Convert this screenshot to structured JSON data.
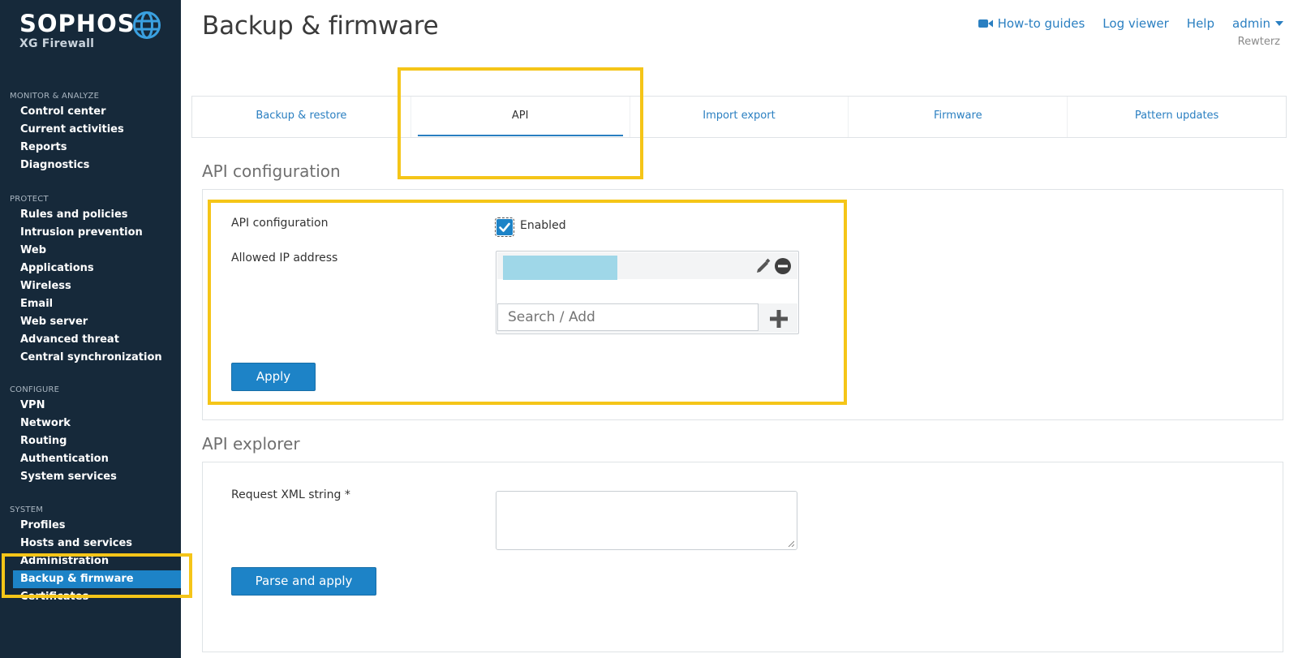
{
  "brand": {
    "name": "SOPHOS",
    "product": "XG Firewall"
  },
  "sidebar": {
    "sections": [
      {
        "heading": "MONITOR & ANALYZE",
        "items": [
          "Control center",
          "Current activities",
          "Reports",
          "Diagnostics"
        ]
      },
      {
        "heading": "PROTECT",
        "items": [
          "Rules and policies",
          "Intrusion prevention",
          "Web",
          "Applications",
          "Wireless",
          "Email",
          "Web server",
          "Advanced threat",
          "Central synchronization"
        ]
      },
      {
        "heading": "CONFIGURE",
        "items": [
          "VPN",
          "Network",
          "Routing",
          "Authentication",
          "System services"
        ]
      },
      {
        "heading": "SYSTEM",
        "items": [
          "Profiles",
          "Hosts and services",
          "Administration",
          "Backup & firmware",
          "Certificates"
        ]
      }
    ],
    "active_item": "Backup & firmware"
  },
  "header": {
    "title": "Backup & firmware",
    "links": {
      "howto": "How-to guides",
      "log_viewer": "Log viewer",
      "help": "Help",
      "user": "admin"
    },
    "org": "Rewterz"
  },
  "tabs": [
    "Backup & restore",
    "API",
    "Import export",
    "Firmware",
    "Pattern updates"
  ],
  "active_tab": "API",
  "api_config": {
    "section_title": "API configuration",
    "field_label": "API configuration",
    "enabled_label": "Enabled",
    "enabled": true,
    "allowed_ip_label": "Allowed IP address",
    "search_placeholder": "Search / Add",
    "apply_label": "Apply"
  },
  "api_explorer": {
    "section_title": "API explorer",
    "request_label": "Request XML string *",
    "request_value": "",
    "button_label": "Parse and apply"
  },
  "colors": {
    "sidebar_bg": "#16293a",
    "accent": "#1d83c7",
    "highlight": "#f5c518"
  }
}
